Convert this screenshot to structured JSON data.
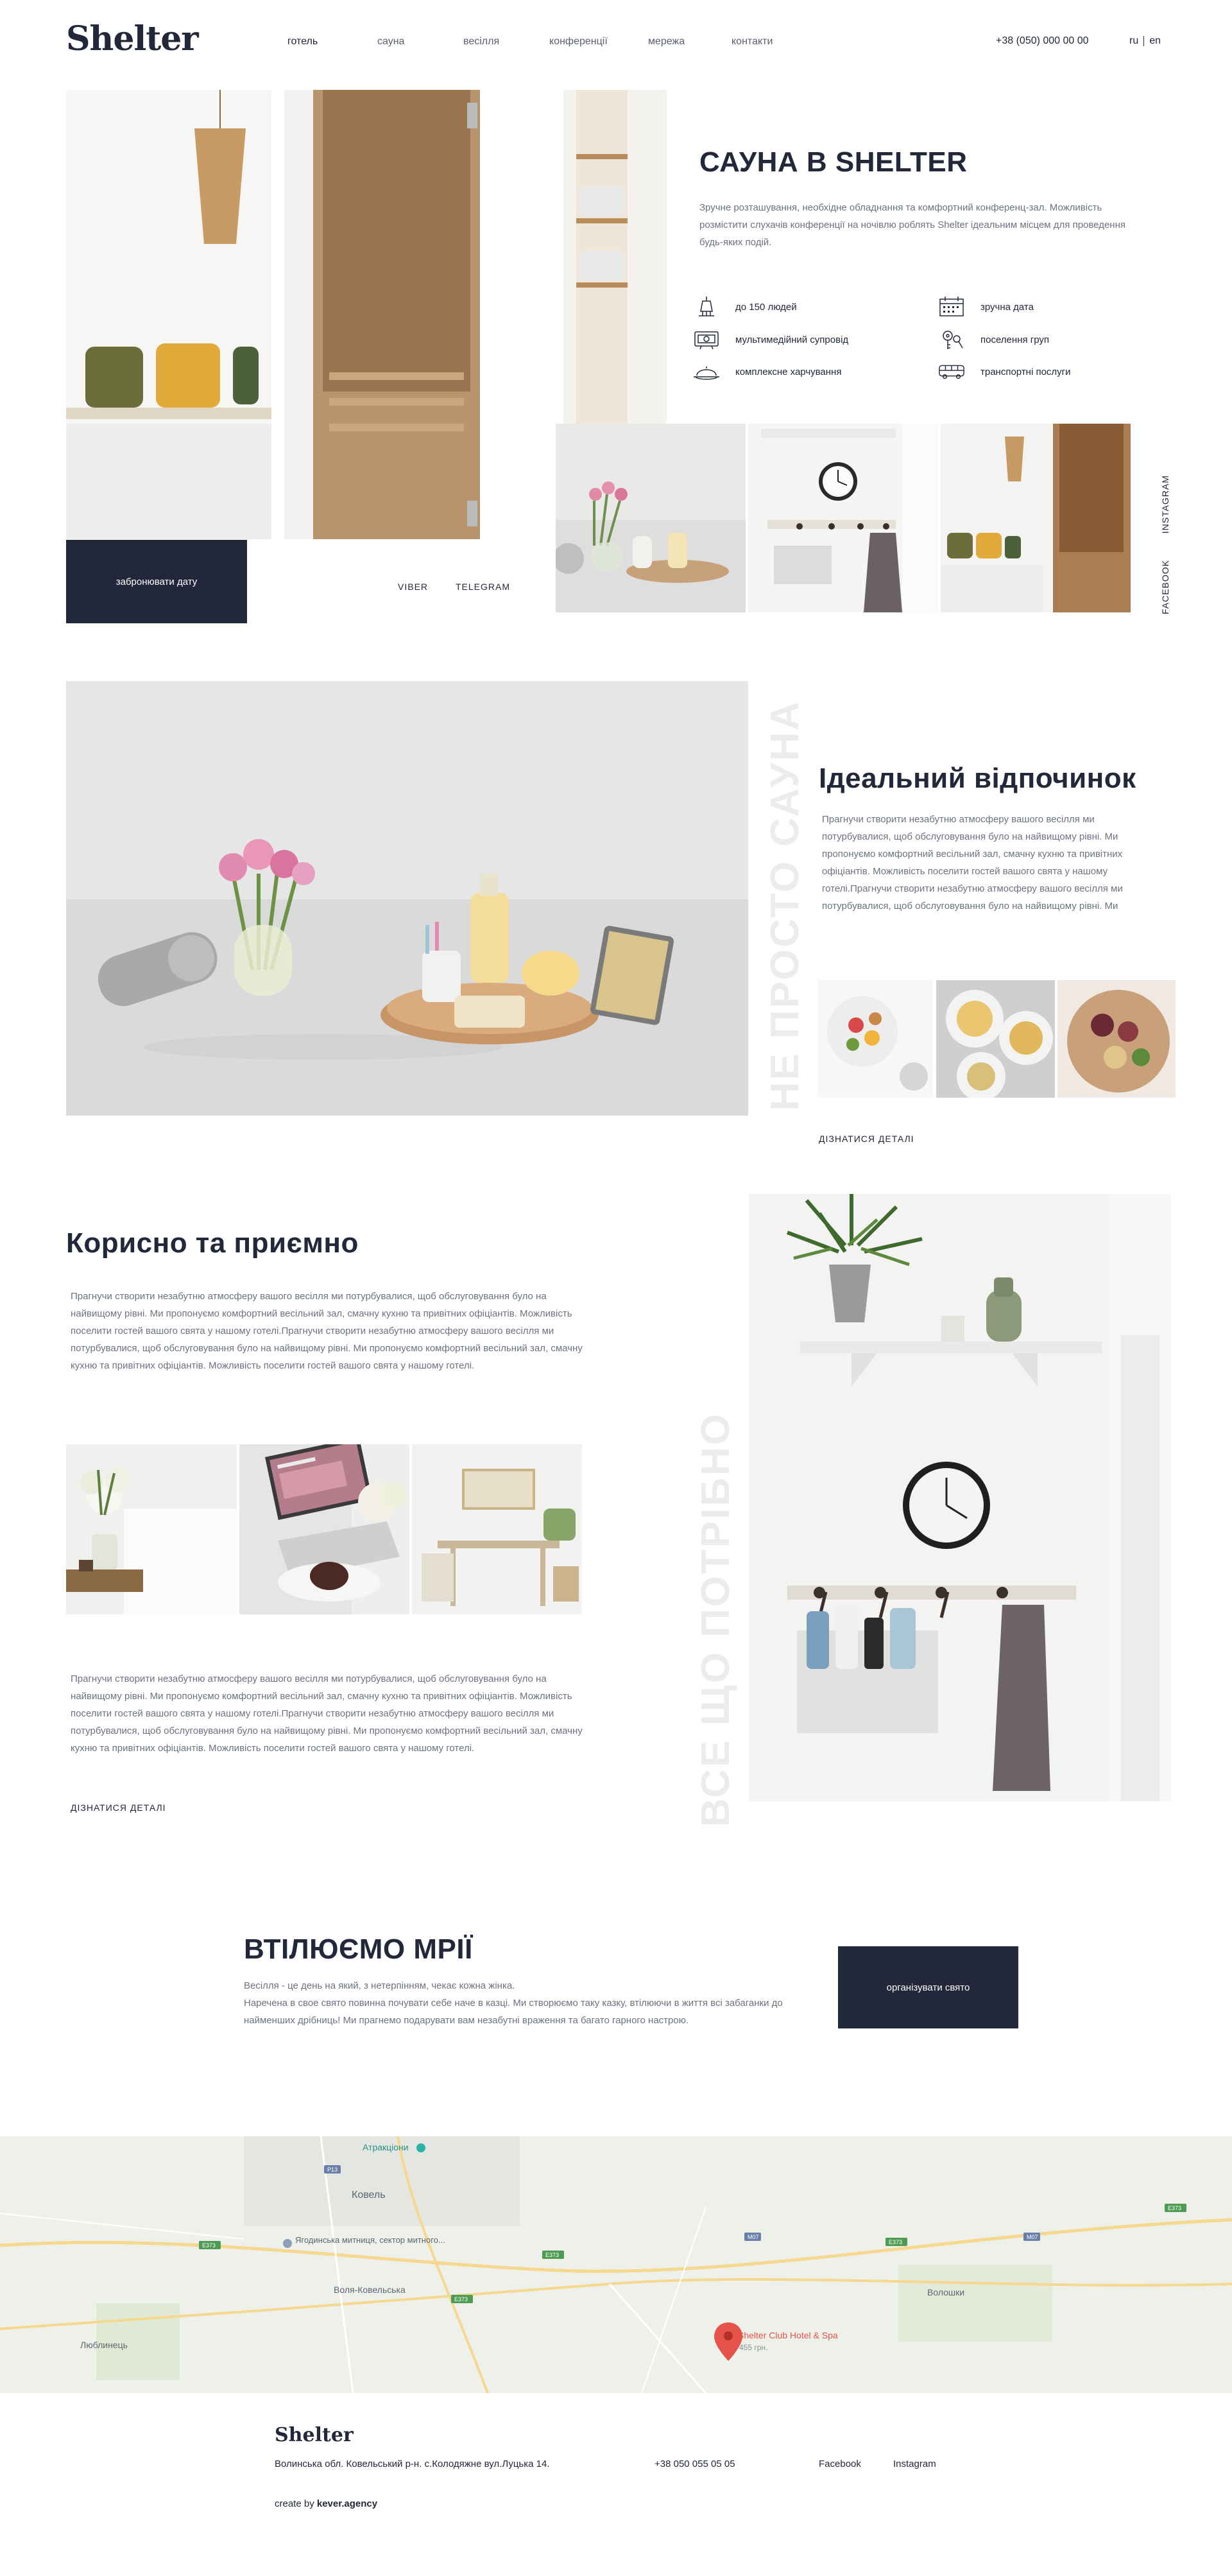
{
  "header": {
    "logo": "Shelter",
    "nav": [
      "готель",
      "сауна",
      "весілля",
      "конференції",
      "мережа",
      "контакти"
    ],
    "phone": "+38 (050) 000 00 00",
    "lang": [
      "ru",
      "en"
    ]
  },
  "sauna": {
    "title": "САУНА В SHELTER",
    "description": "Зручне розташування, необхідне обладнання та комфортний конференц-зал. Можливість розмістити слухачів конференції на ночівлю роблять Shelter ідеальним місцем для проведення будь-яких подій.",
    "features": [
      {
        "icon": "chandelier-icon",
        "label": "до 150 людей"
      },
      {
        "icon": "calendar-icon",
        "label": "зручна дата"
      },
      {
        "icon": "projector-icon",
        "label": "мультимедійний супровід"
      },
      {
        "icon": "keys-icon",
        "label": "поселення груп"
      },
      {
        "icon": "food-tray-icon",
        "label": "комплексне харчування"
      },
      {
        "icon": "bus-icon",
        "label": "транспортні послуги"
      }
    ],
    "book_button": "забронювати дату",
    "messengers": [
      "VIBER",
      "TELEGRAM"
    ],
    "social": [
      "INSTAGRAM",
      "FACEBOOK"
    ]
  },
  "rest": {
    "vertical_title": "НЕ ПРОСТО САУНА",
    "title": "Ідеальний відпочинок",
    "text": "Прагнучи створити незабутню атмосферу вашого весілля ми потурбувалися, щоб обслуговування було на найвищому рівні. Ми пропонуємо комфортний весільний зал, смачну кухню та привітних офіціантів. Можливість поселити гостей вашого свята у нашому готелі.Прагнучи створити незабутню атмосферу вашого весілля ми потурбувалися, щоб обслуговування було на найвищому рівні. Ми",
    "link": "ДІЗНАТИСЯ ДЕТАЛІ"
  },
  "useful": {
    "title": "Корисно та приємно",
    "text1": "Прагнучи створити незабутню атмосферу вашого весілля ми потурбувалися, щоб обслуговування було на найвищому рівні. Ми пропонуємо комфортний весільний зал, смачну кухню та привітних офіціантів. Можливість поселити гостей вашого свята у нашому готелі.Прагнучи створити незабутню атмосферу вашого весілля ми потурбувалися, щоб обслуговування було на найвищому рівні. Ми пропонуємо комфортний весільний зал, смачну кухню та привітних офіціантів. Можливість поселити гостей вашого свята у нашому готелі.",
    "text2": "Прагнучи створити незабутню атмосферу вашого весілля ми потурбувалися, щоб обслуговування було на найвищому рівні. Ми пропонуємо комфортний весільний зал, смачну кухню та привітних офіціантів. Можливість поселити гостей вашого свята у нашому готелі.Прагнучи створити незабутню атмосферу вашого весілля ми потурбувалися, щоб обслуговування було на найвищому рівні. Ми пропонуємо комфортний весільний зал, смачну кухню та привітних офіціантів. Можливість поселити гостей вашого свята у нашому готелі.",
    "link": "ДІЗНАТИСЯ ДЕТАЛІ",
    "vertical_title": "ВСЕ ЩО ПОТРІБНО"
  },
  "dreams": {
    "title": "ВТІЛЮЄМО МРІЇ",
    "line1": "Весілля - це день на який, з нетерпінням, чекає кожна жінка.",
    "line2": "Наречена в свое свято повинна почувати себе наче в казці. Ми створюємо таку казку, втілюючи в життя всі забаганки до найменших дрібниць! Ми прагнемо подарувати вам незабутні враження та багато гарного настрою.",
    "button": "організувати свято"
  },
  "map": {
    "places": [
      {
        "name": "Атракціони"
      },
      {
        "name": "Ковель"
      },
      {
        "name": "Ягодинська митниця, сектор митного..."
      },
      {
        "name": "Воля-Ковельська"
      },
      {
        "name": "Волошки"
      },
      {
        "name": "Люблинець"
      },
      {
        "name": "Shelter Club Hotel & Spa"
      },
      {
        "name": "455 грн."
      }
    ],
    "road_labels": [
      "P13",
      "H22",
      "E373",
      "M07",
      "E373",
      "M07",
      "E373",
      "E373",
      "E85",
      "E373"
    ]
  },
  "footer": {
    "logo": "Shelter",
    "address": "Волинська обл. Ковельський р-н. с.Колодяжне вул.Луцька 14.",
    "phone": "+38 050 055 05 05",
    "facebook": "Facebook",
    "instagram": "Instagram",
    "credit_prefix": "create by",
    "credit_brand": "kever.agency"
  },
  "colors": {
    "dark": "#22283a",
    "text_muted": "#6c7280",
    "vertical_heading": "#ececec",
    "map_pin": "#e5534b"
  }
}
